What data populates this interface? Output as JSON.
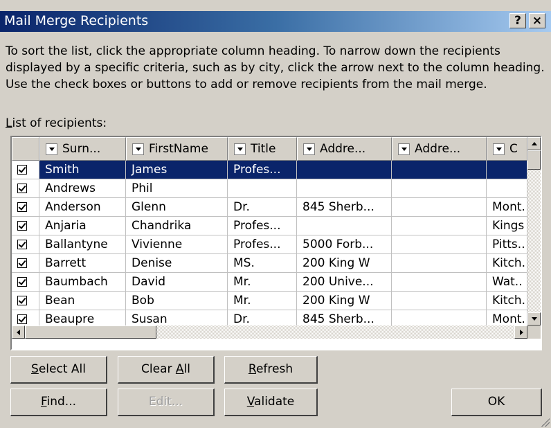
{
  "window": {
    "title": "Mail Merge Recipients",
    "help_label": "?",
    "close_label": "×"
  },
  "instructions": "To sort the list, click the appropriate column heading.  To narrow down the recipients displayed by a specific criteria, such as by city, click the arrow next to the column heading.  Use the check boxes or buttons to add or remove recipients from the mail merge.",
  "list_label_prefix": "L",
  "list_label_rest": "ist of recipients:",
  "columns": [
    "Surn...",
    "FirstName",
    "Title",
    "Addre...",
    "Addre...",
    "C"
  ],
  "rows": [
    {
      "checked": true,
      "selected": true,
      "cells": [
        "Smith",
        "James",
        "Profes...",
        "",
        "",
        ""
      ]
    },
    {
      "checked": true,
      "selected": false,
      "cells": [
        "Andrews",
        "Phil",
        "",
        "",
        "",
        ""
      ]
    },
    {
      "checked": true,
      "selected": false,
      "cells": [
        "Anderson",
        "Glenn",
        "Dr.",
        "845 Sherb...",
        "",
        "Mont."
      ]
    },
    {
      "checked": true,
      "selected": false,
      "cells": [
        "Anjaria",
        "Chandrika",
        "Profes...",
        "",
        "",
        "Kings"
      ]
    },
    {
      "checked": true,
      "selected": false,
      "cells": [
        "Ballantyne",
        "Vivienne",
        "Profes...",
        "5000 Forb...",
        "",
        "Pitts.."
      ]
    },
    {
      "checked": true,
      "selected": false,
      "cells": [
        "Barrett",
        "Denise",
        "MS.",
        "200 King W",
        "",
        "Kitch."
      ]
    },
    {
      "checked": true,
      "selected": false,
      "cells": [
        "Baumbach",
        "David",
        "Mr.",
        "200 Unive...",
        "",
        "Wat.."
      ]
    },
    {
      "checked": true,
      "selected": false,
      "cells": [
        "Bean",
        "Bob",
        "Mr.",
        "200 King W",
        "",
        "Kitch."
      ]
    },
    {
      "checked": true,
      "selected": false,
      "cells": [
        "Beaupre",
        "Susan",
        "Dr.",
        "845 Sherb...",
        "",
        "Mont."
      ]
    }
  ],
  "buttons": {
    "select_all": {
      "mnemonic": "S",
      "rest": "elect All"
    },
    "clear_all": {
      "pre": "Clear ",
      "mnemonic": "A",
      "rest": "ll"
    },
    "refresh": {
      "mnemonic": "R",
      "rest": "efresh"
    },
    "find": {
      "mnemonic": "F",
      "rest": "ind..."
    },
    "edit": "Edit...",
    "validate": {
      "mnemonic": "V",
      "rest": "alidate"
    },
    "ok": "OK"
  },
  "colors": {
    "selection": "#0a246a",
    "title_gradient_start": "#0a246a",
    "title_gradient_end": "#a6caf0",
    "dialog_face": "#d4d0c8"
  }
}
